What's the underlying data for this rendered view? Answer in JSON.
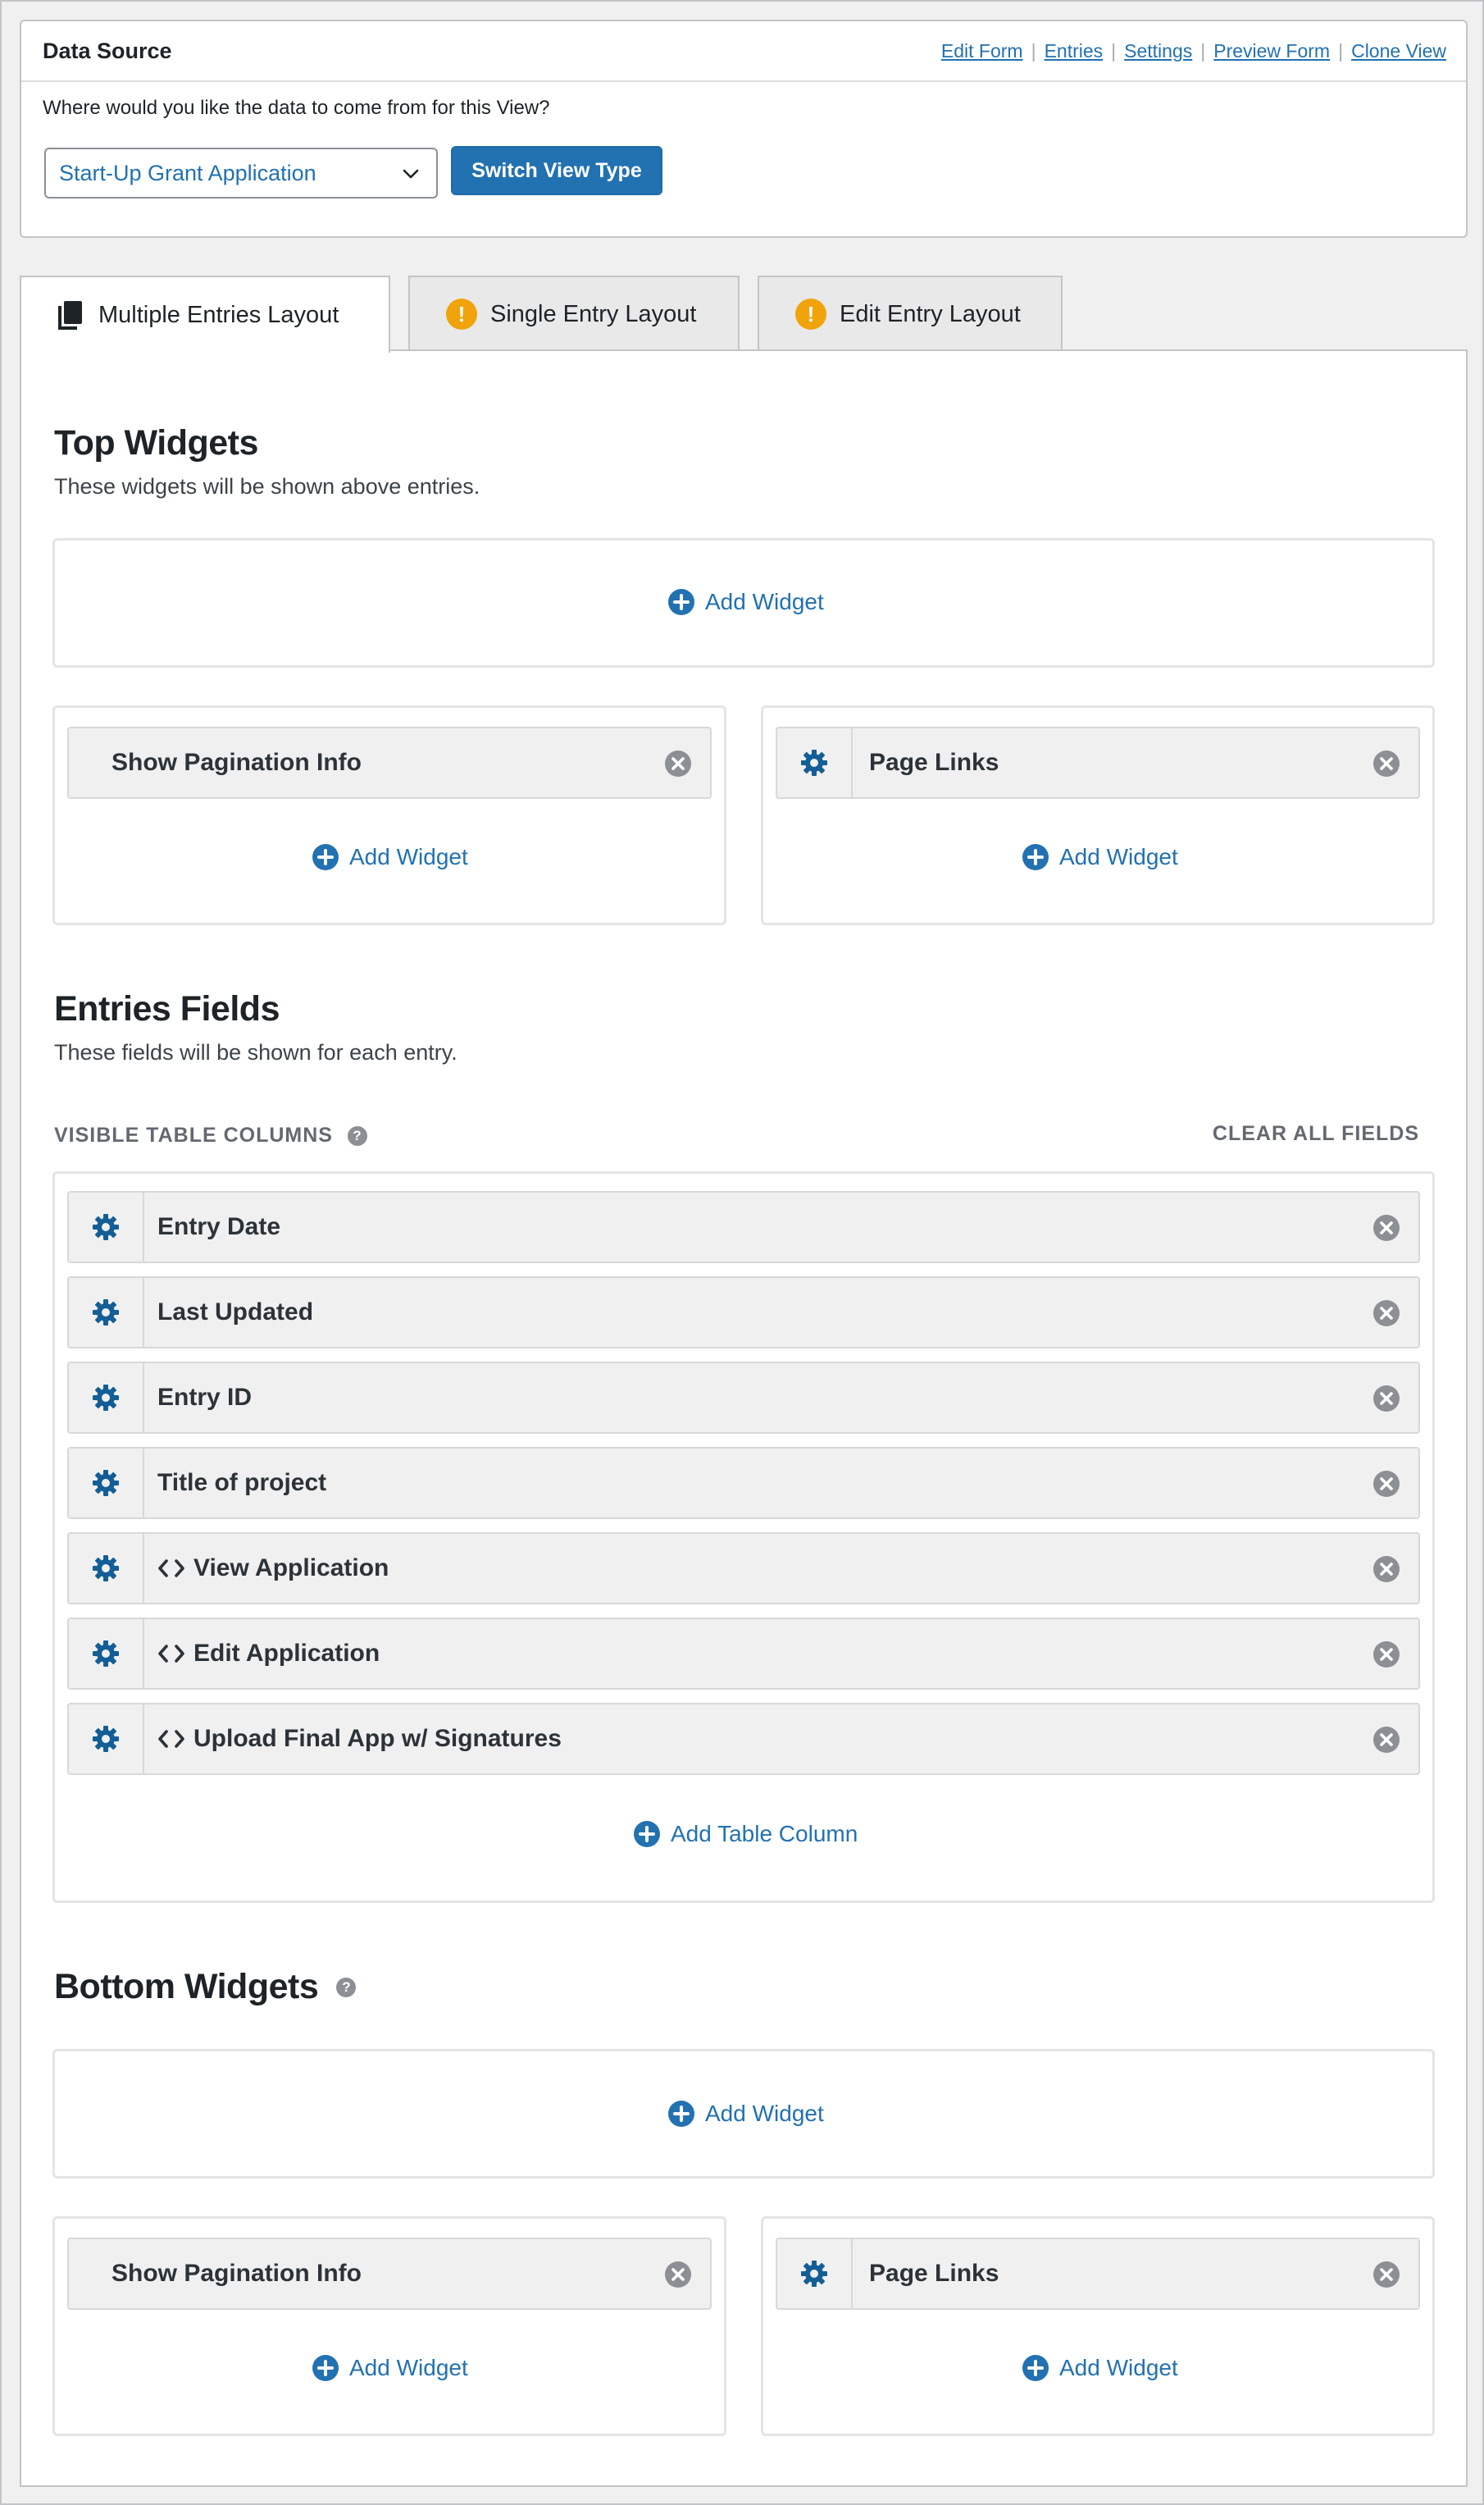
{
  "data_source": {
    "title": "Data Source",
    "links": [
      "Edit Form",
      "Entries",
      "Settings",
      "Preview Form",
      "Clone View"
    ],
    "separator": "|",
    "question": "Where would you like the data to come from for this View?",
    "selected_form": "Start-Up Grant Application",
    "switch_button": "Switch View Type"
  },
  "tabs": [
    {
      "label": "Multiple Entries Layout",
      "icon": "layout-icon",
      "active": true
    },
    {
      "label": "Single Entry Layout",
      "icon": "warning-icon",
      "active": false
    },
    {
      "label": "Edit Entry Layout",
      "icon": "warning-icon",
      "active": false
    }
  ],
  "warning_glyph": "!",
  "help_glyph": "?",
  "top_widgets": {
    "title": "Top Widgets",
    "description": "These widgets will be shown above entries.",
    "add_widget": "Add Widget",
    "left_widget": "Show Pagination Info",
    "right_widget": "Page Links"
  },
  "entries_fields": {
    "title": "Entries Fields",
    "description": "These fields will be shown for each entry.",
    "columns_heading": "VISIBLE TABLE COLUMNS",
    "clear_all": "CLEAR ALL FIELDS",
    "fields": [
      {
        "label": "Entry Date",
        "custom": false
      },
      {
        "label": "Last Updated",
        "custom": false
      },
      {
        "label": "Entry ID",
        "custom": false
      },
      {
        "label": "Title of project",
        "custom": false
      },
      {
        "label": "View Application",
        "custom": true
      },
      {
        "label": "Edit Application",
        "custom": true
      },
      {
        "label": "Upload Final App w/ Signatures",
        "custom": true
      }
    ],
    "add_column": "Add Table Column"
  },
  "bottom_widgets": {
    "title": "Bottom Widgets",
    "add_widget": "Add Widget",
    "left_widget": "Show Pagination Info",
    "right_widget": "Page Links"
  },
  "colors": {
    "accent": "#2271b1",
    "gear": "#135e96",
    "close": "#8c8f94",
    "warning": "#f0a30a"
  }
}
